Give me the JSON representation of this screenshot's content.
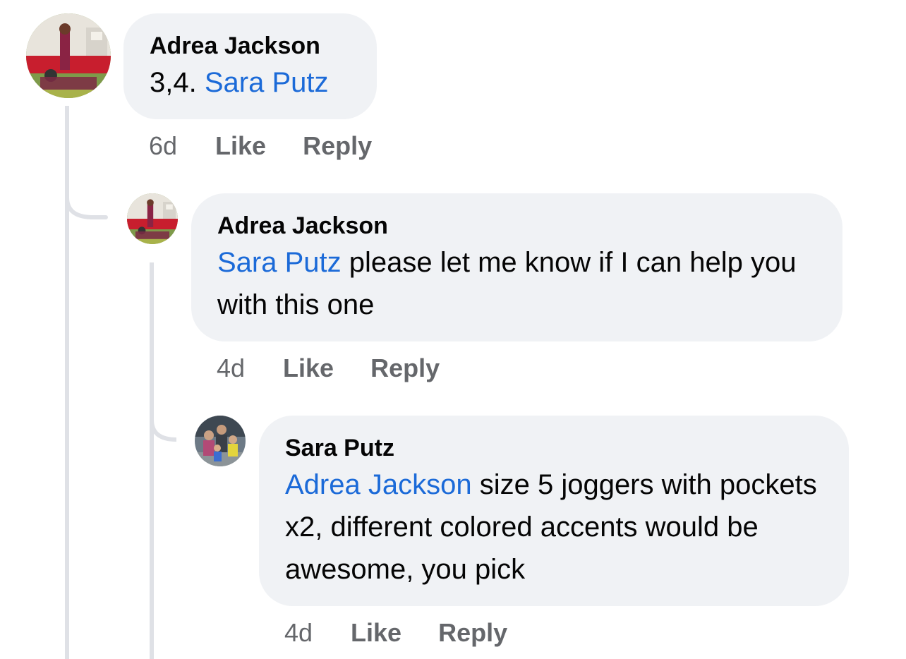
{
  "comments": [
    {
      "author": "Adrea Jackson",
      "segments": [
        {
          "text": "3,4. ",
          "mention": false
        },
        {
          "text": "Sara Putz",
          "mention": true
        }
      ],
      "time": "6d",
      "like_label": "Like",
      "reply_label": "Reply"
    },
    {
      "author": "Adrea Jackson",
      "segments": [
        {
          "text": "Sara Putz",
          "mention": true
        },
        {
          "text": " please let me know if I can help you with this one",
          "mention": false
        }
      ],
      "time": "4d",
      "like_label": "Like",
      "reply_label": "Reply"
    },
    {
      "author": "Sara Putz",
      "segments": [
        {
          "text": "Adrea Jackson",
          "mention": true
        },
        {
          "text": " size 5 joggers with pockets x2, different colored accents would be awesome, you pick",
          "mention": false
        }
      ],
      "time": "4d",
      "like_label": "Like",
      "reply_label": "Reply"
    }
  ],
  "colors": {
    "bubble_bg": "#f0f2f5",
    "mention": "#1b6ad8",
    "meta_text": "#65676b",
    "thread_line": "#dfe1e6"
  }
}
